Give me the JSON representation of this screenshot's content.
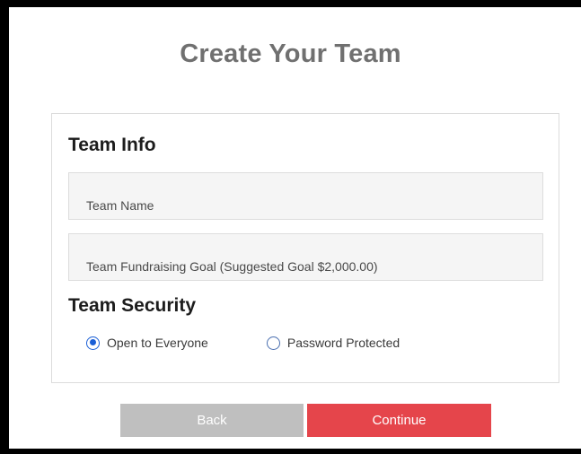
{
  "page": {
    "title": "Create Your Team"
  },
  "team_info": {
    "heading": "Team Info",
    "team_name_placeholder": "Team Name",
    "team_name_value": "",
    "goal_placeholder": "Team Fundraising Goal (Suggested Goal $2,000.00)",
    "goal_value": ""
  },
  "team_security": {
    "heading": "Team Security",
    "options": [
      {
        "label": "Open to Everyone",
        "selected": true
      },
      {
        "label": "Password Protected",
        "selected": false
      }
    ]
  },
  "actions": {
    "back_label": "Back",
    "continue_label": "Continue"
  },
  "colors": {
    "title": "#707070",
    "radio_accent": "#1a5fd6",
    "back_button": "#bfbfbf",
    "continue_button": "#e5454b",
    "frame": "#000000"
  },
  "icons": {
    "radio_selected": "radio-checked-icon",
    "radio_unselected": "radio-unchecked-icon"
  }
}
